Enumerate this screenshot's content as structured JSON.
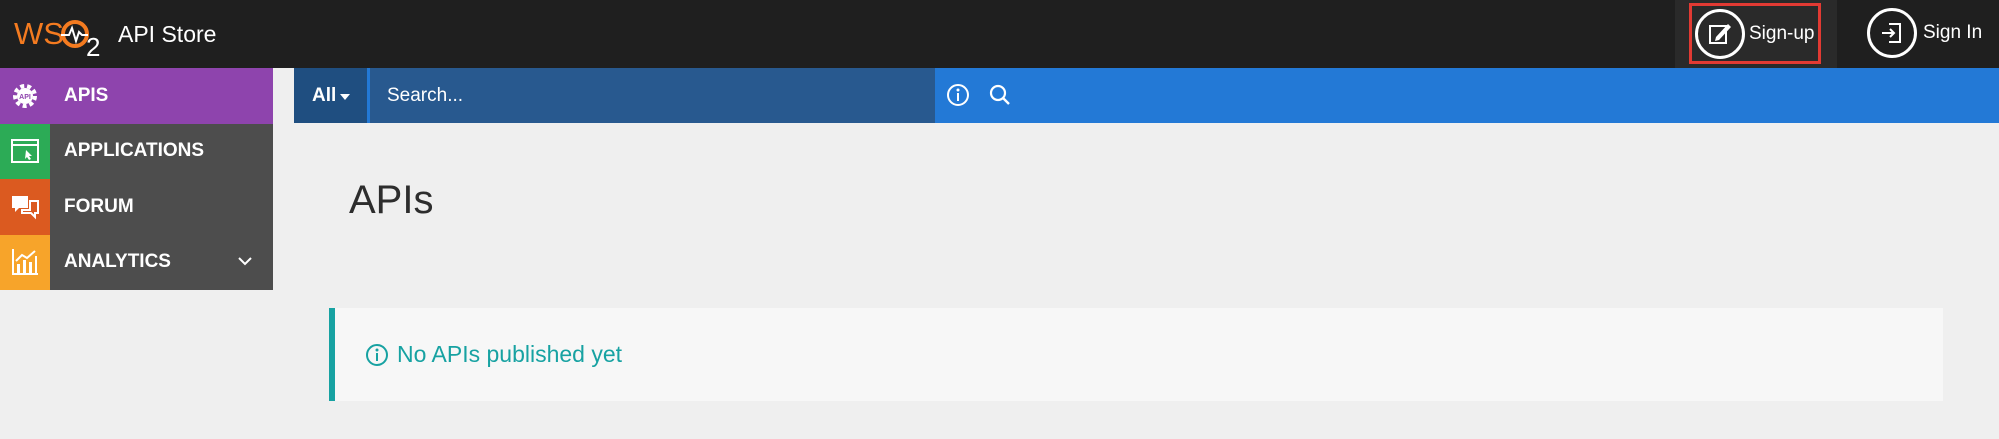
{
  "header": {
    "logo_text": "WSO2",
    "title": "API Store",
    "signup_label": "Sign-up",
    "signin_label": "Sign In",
    "signup_highlight_color": "#e23a33"
  },
  "sidebar": {
    "items": [
      {
        "label": "APIS",
        "icon": "api-gear-icon",
        "color": "#8e44ad"
      },
      {
        "label": "APPLICATIONS",
        "icon": "application-window-icon",
        "color": "#2cab56"
      },
      {
        "label": "FORUM",
        "icon": "chat-bubbles-icon",
        "color": "#db5a20"
      },
      {
        "label": "ANALYTICS",
        "icon": "bar-chart-icon",
        "color": "#f7a42a"
      }
    ]
  },
  "search": {
    "filter_label": "All",
    "placeholder": "Search..."
  },
  "main": {
    "page_title": "APIs",
    "alert_text": "No APIs published yet",
    "alert_color": "#17a2a2"
  }
}
